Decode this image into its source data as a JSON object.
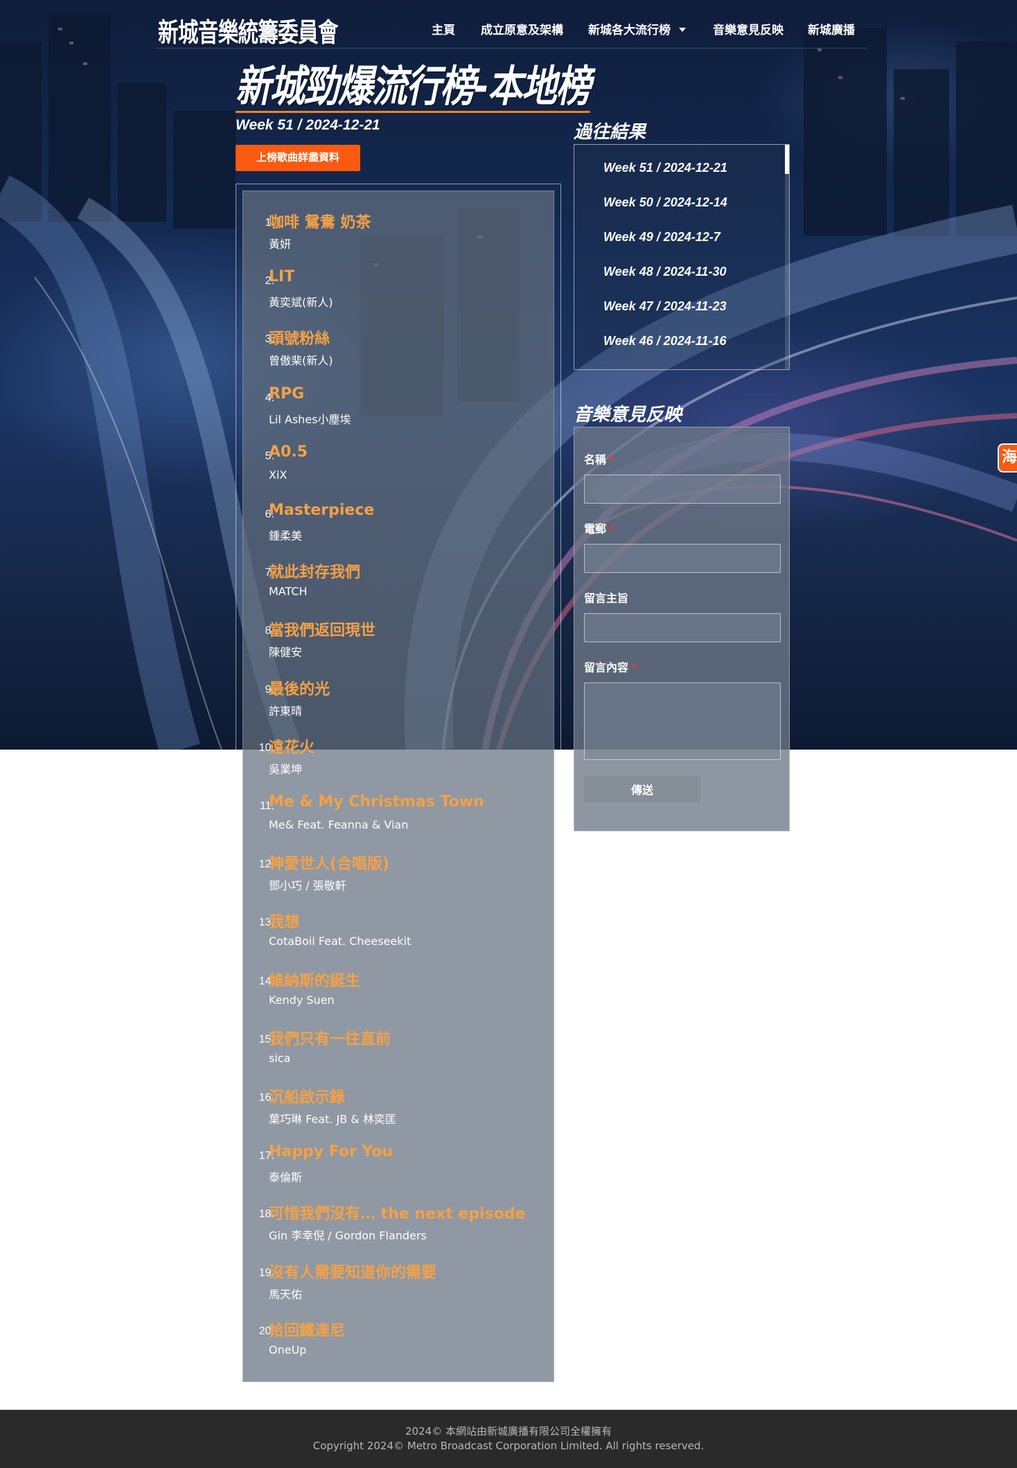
{
  "site": {
    "logo": "新城音樂統籌委員會"
  },
  "nav": {
    "items": [
      {
        "label": "主頁"
      },
      {
        "label": "成立原意及架構"
      },
      {
        "label": "新城各大流行榜"
      },
      {
        "label": "音樂意見反映"
      },
      {
        "label": "新城廣播"
      }
    ]
  },
  "page": {
    "title": "新城勁爆流行榜-本地榜",
    "week": "Week 51 / 2024-12-21",
    "detail_button": "上榜歌曲詳盡資料"
  },
  "songs": [
    {
      "rank": "1.",
      "title": "咖啡 鴛鴦 奶茶",
      "artist": "黃妍"
    },
    {
      "rank": "2.",
      "title": "LIT",
      "artist": "黃奕斌(新人)"
    },
    {
      "rank": "3.",
      "title": "頭號粉絲",
      "artist": "曾傲棐(新人)"
    },
    {
      "rank": "4.",
      "title": "RPG",
      "artist": "Lil Ashes小塵埃"
    },
    {
      "rank": "5.",
      "title": "A0.5",
      "artist": "XiX"
    },
    {
      "rank": "6.",
      "title": "Masterpiece",
      "artist": "鍾柔美"
    },
    {
      "rank": "7.",
      "title": "就此封存我們",
      "artist": "MATCH"
    },
    {
      "rank": "8.",
      "title": "當我們返回現世",
      "artist": "陳健安"
    },
    {
      "rank": "9.",
      "title": "最後的光",
      "artist": "許東晴"
    },
    {
      "rank": "10.",
      "title": "遠花火",
      "artist": "吳業坤"
    },
    {
      "rank": "11.",
      "title": "Me & My Christmas Town",
      "artist": "Me& Feat. Feanna & Vian"
    },
    {
      "rank": "12.",
      "title": "神愛世人(合唱版)",
      "artist": "鄧小巧 / 張敬軒"
    },
    {
      "rank": "13.",
      "title": "我想",
      "artist": "CotaBoii Feat. Cheeseekit"
    },
    {
      "rank": "14.",
      "title": "維納斯的誕生",
      "artist": "Kendy Suen"
    },
    {
      "rank": "15.",
      "title": "我們只有一往直前",
      "artist": "sica"
    },
    {
      "rank": "16.",
      "title": "沉船啟示錄",
      "artist": "葉巧琳 Feat. JB & 林奕匡"
    },
    {
      "rank": "17.",
      "title": "Happy For You",
      "artist": "泰倫斯"
    },
    {
      "rank": "18.",
      "title": "可惜我們沒有… the next episode",
      "artist": "Gin 李幸倪 / Gordon Flanders"
    },
    {
      "rank": "19.",
      "title": "沒有人需要知道你的需要",
      "artist": "馬天佑"
    },
    {
      "rank": "20.",
      "title": "拾回鐵達尼",
      "artist": "OneUp"
    }
  ],
  "past": {
    "heading": "過往結果",
    "items": [
      "Week 51 / 2024-12-21",
      "Week 50 / 2024-12-14",
      "Week 49 / 2024-12-7",
      "Week 48 / 2024-11-30",
      "Week 47 / 2024-11-23",
      "Week 46 / 2024-11-16"
    ]
  },
  "feedback": {
    "heading": "音樂意見反映",
    "name_label": "名稱",
    "email_label": "電郵",
    "subject_label": "留言主旨",
    "message_label": "留言內容",
    "required_mark": "*",
    "send_label": "傳送"
  },
  "edge_tab": {
    "label": "海"
  },
  "footer": {
    "line1": "2024© 本網站由新城廣播有限公司全權擁有",
    "line2": "Copyright 2024© Metro Broadcast Corporation Limited. All rights reserved."
  },
  "colors": {
    "accent": "#fa5a0f",
    "song_title": "#f5a146",
    "footer_bg": "#2a2a2a"
  }
}
